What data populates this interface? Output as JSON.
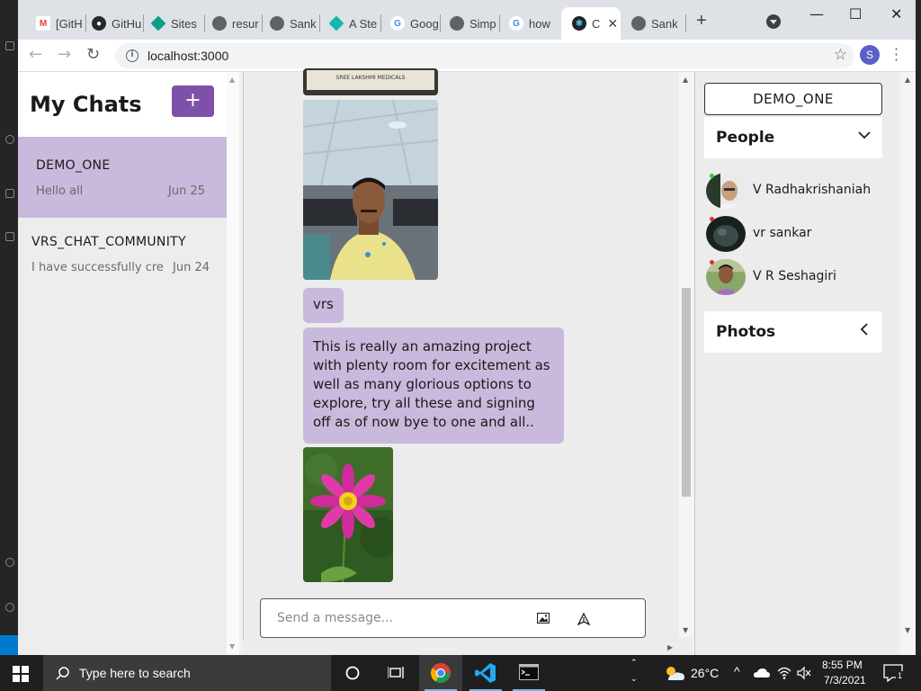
{
  "browser": {
    "tabs": [
      {
        "label": "[GitH",
        "icon": "gmail-icon"
      },
      {
        "label": "GitHu",
        "icon": "github-icon"
      },
      {
        "label": "Sites",
        "icon": "sites-icon"
      },
      {
        "label": "resur",
        "icon": "globe-icon"
      },
      {
        "label": "Sank",
        "icon": "globe-icon"
      },
      {
        "label": "A Ste",
        "icon": "diamond-icon"
      },
      {
        "label": "Goog",
        "icon": "google-icon"
      },
      {
        "label": "Simp",
        "icon": "globe-icon"
      },
      {
        "label": "how",
        "icon": "google-icon"
      },
      {
        "label": "C",
        "icon": "react-icon",
        "active": true
      },
      {
        "label": "Sank",
        "icon": "globe-icon"
      }
    ],
    "new_tab": "+",
    "url": "localhost:3000",
    "profile_initial": "S",
    "window_controls": {
      "minimize": "—",
      "maximize": "☐",
      "close": "✕"
    }
  },
  "sidebar": {
    "title": "My Chats",
    "new_button": "+",
    "chats": [
      {
        "name": "DEMO_ONE",
        "last_message": "Hello all",
        "date": "Jun 25",
        "selected": true
      },
      {
        "name": "VRS_CHAT_COMMUNITY",
        "last_message": "I have successfully cre",
        "date": "Jun 24",
        "selected": false
      }
    ]
  },
  "chat": {
    "messages": [
      {
        "type": "image",
        "alt": "SREE LAKSHMI MEDICALS"
      },
      {
        "type": "image",
        "alt": "selfie"
      },
      {
        "type": "text",
        "text": "vrs"
      },
      {
        "type": "text",
        "lines": [
          "This is really an amazing project",
          "with plenty room for excitement as",
          "well as many glorious options to",
          "explore, try all these and signing",
          "off as of now bye to one and all.."
        ]
      },
      {
        "type": "image",
        "alt": "pink flower"
      }
    ],
    "composer_placeholder": "Send a message...",
    "signboard_text": "SREE LAKSHMI MEDICALS"
  },
  "details": {
    "room_name": "DEMO_ONE",
    "people_header": "People",
    "people": [
      {
        "name": "V Radhakrishaniah",
        "status_color": "#2ecc40"
      },
      {
        "name": "vr sankar",
        "status_color": "#e03030"
      },
      {
        "name": "V R Seshagiri",
        "status_color": "#e03030"
      }
    ],
    "photos_header": "Photos"
  },
  "taskbar": {
    "search_placeholder": "Type here to search",
    "temperature": "26°C",
    "time": "8:55 PM",
    "date": "7/3/2021",
    "notification_count": "1"
  },
  "colors": {
    "accent": "#7e50a8",
    "bubble": "#c9b9dc",
    "selected_chat": "#c9b9dc"
  }
}
